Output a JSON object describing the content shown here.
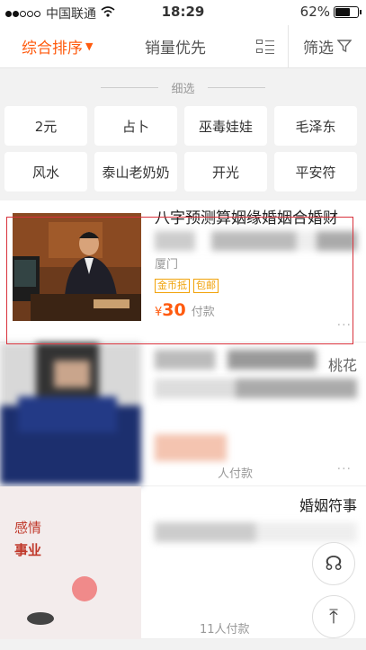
{
  "status_bar": {
    "carrier": "中国联通",
    "time": "18:29",
    "battery": "62%"
  },
  "tabs": {
    "sort": "综合排序",
    "sales": "销量优先",
    "filter": "筛选"
  },
  "refine": {
    "title": "细选",
    "chips": [
      "2元",
      "占卜",
      "巫毒娃娃",
      "毛泽东",
      "风水",
      "泰山老奶奶",
      "开光",
      "平安符"
    ]
  },
  "items": [
    {
      "title": "八字预测算姻缘婚姻合婚财",
      "location": "厦门",
      "tags": [
        "金币抵",
        "包邮"
      ],
      "currency": "¥",
      "price": "30",
      "sold": "付款",
      "more": "···"
    },
    {
      "title": "桃花",
      "sold": "人付款",
      "more": "···"
    },
    {
      "title": "婚姻符事",
      "image_text": [
        "感情",
        "事业"
      ],
      "sold": "11人付款",
      "more": "···"
    }
  ],
  "floating": {
    "back_to_top": "⤒",
    "feedback": "☊"
  }
}
